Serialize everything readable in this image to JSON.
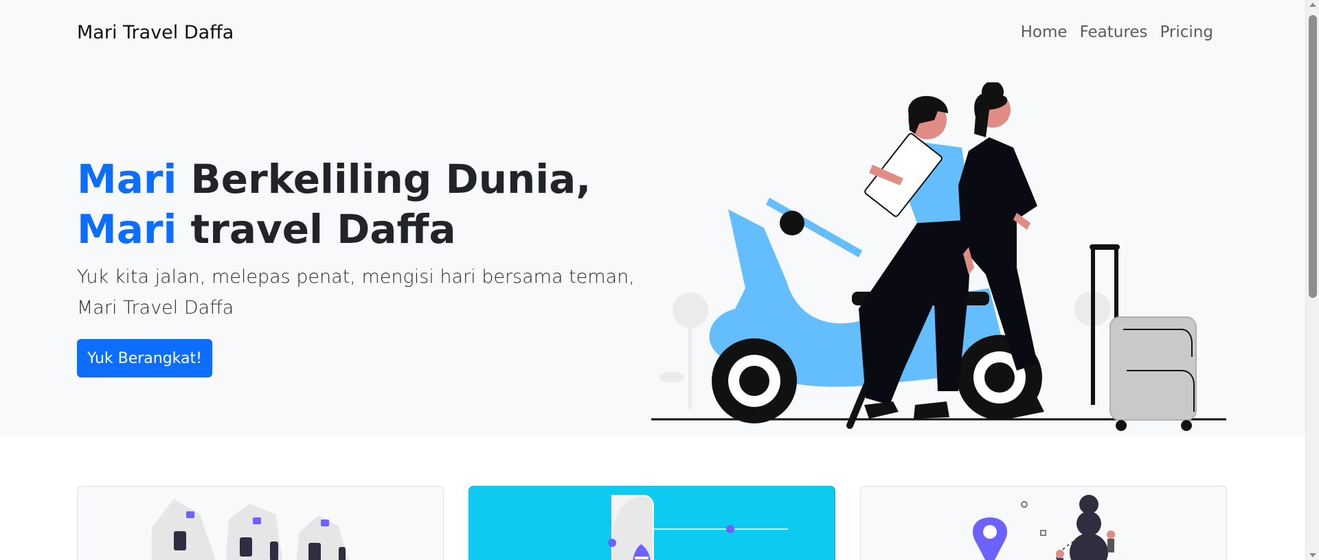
{
  "navbar": {
    "brand": "Mari Travel Daffa",
    "links": [
      {
        "label": "Home"
      },
      {
        "label": "Features"
      },
      {
        "label": "Pricing"
      }
    ]
  },
  "hero": {
    "title_part1": "Mari",
    "title_part2": " Berkeliling Dunia, ",
    "title_part3": "Mari",
    "title_part4": " travel Daffa",
    "lead": "Yuk kita jalan, melepas penat, mengisi hari bersama teman, Mari Travel Daffa",
    "cta_label": "Yuk Berangkat!"
  },
  "colors": {
    "accent": "#0d6efd",
    "hero_bg": "#f8f9fa",
    "scooter": "#64bdfc",
    "card_cyan": "#0dcaf0",
    "illustration_purple": "#6c63ff"
  },
  "illustrations": {
    "hero": "couple-with-scooter-and-luggage-illustration",
    "card_1": "houses-illustration",
    "card_2": "airplane-illustration",
    "card_3": "map-pin-illustration"
  }
}
